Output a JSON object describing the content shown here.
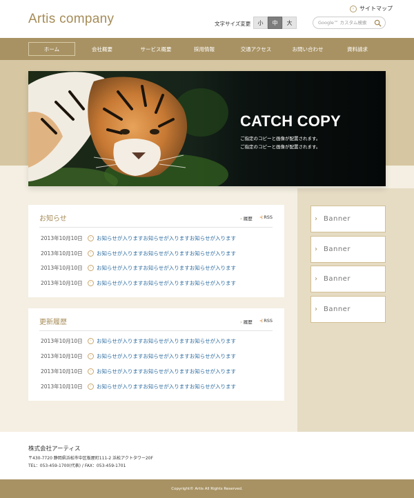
{
  "header": {
    "logo": "Artis company",
    "sitemap_label": "サイトマップ",
    "fontsize_label": "文字サイズ変更",
    "fontsize_buttons": [
      "小",
      "中",
      "大"
    ],
    "fontsize_selected": "中",
    "search_placeholder": "Google™ カスタム検索"
  },
  "nav": {
    "items": [
      "ホーム",
      "会社概要",
      "サービス概要",
      "採用情報",
      "交通アクセス",
      "お問い合わせ",
      "資料請求"
    ],
    "active": "ホーム"
  },
  "hero": {
    "catch": "CATCH COPY",
    "sub_lines": [
      "ご指定のコピーと画像が配置されます。",
      "ご指定のコピーと画像が配置されます。"
    ]
  },
  "news": {
    "title": "お知らせ",
    "archive_label": "履歴",
    "rss_label": "RSS",
    "items": [
      {
        "date": "2013年10月10日",
        "text": "お知らせが入りますお知らせが入りますお知らせが入ります"
      },
      {
        "date": "2013年10月10日",
        "text": "お知らせが入りますお知らせが入りますお知らせが入ります"
      },
      {
        "date": "2013年10月10日",
        "text": "お知らせが入りますお知らせが入りますお知らせが入ります"
      },
      {
        "date": "2013年10月10日",
        "text": "お知らせが入りますお知らせが入りますお知らせが入ります"
      }
    ]
  },
  "updates": {
    "title": "更新履歴",
    "archive_label": "履歴",
    "rss_label": "RSS",
    "items": [
      {
        "date": "2013年10月10日",
        "text": "お知らせが入りますお知らせが入りますお知らせが入ります"
      },
      {
        "date": "2013年10月10日",
        "text": "お知らせが入りますお知らせが入りますお知らせが入ります"
      },
      {
        "date": "2013年10月10日",
        "text": "お知らせが入りますお知らせが入りますお知らせが入ります"
      },
      {
        "date": "2013年10月10日",
        "text": "お知らせが入りますお知らせが入りますお知らせが入ります"
      }
    ]
  },
  "banners": [
    "Banner",
    "Banner",
    "Banner",
    "Banner"
  ],
  "footer": {
    "company": "株式会社アーティス",
    "address_line1": "〒430-7720 静岡県浜松市中区板屋町111-2 浜松アクトタワー20F",
    "address_line2": "TEL：053-459-1700(代表) / FAX：053-459-1701",
    "copyright": "Copyright© Artis All Rights Reserved."
  },
  "colors": {
    "brand": "#a89263",
    "accent_text": "#a58b57",
    "link": "#2b6ba0",
    "band_light": "#f4efe2",
    "band_dark": "#d6c7a2"
  }
}
